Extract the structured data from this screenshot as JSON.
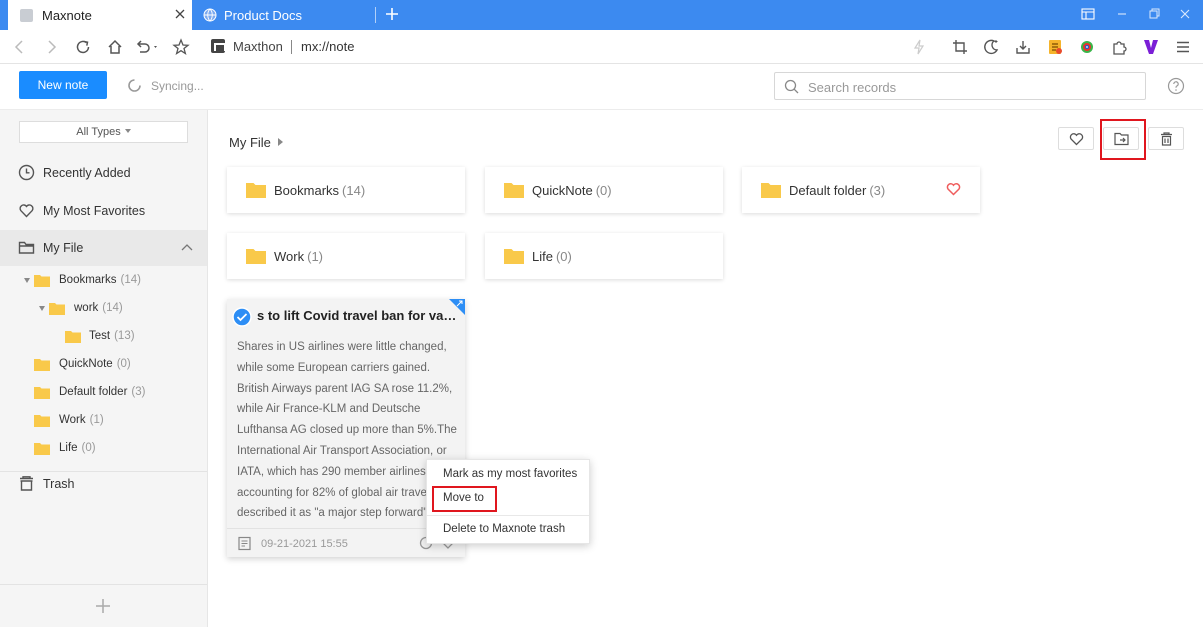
{
  "browser": {
    "tabs": [
      {
        "title": "Maxnote"
      },
      {
        "title": "Product Docs"
      }
    ],
    "address": {
      "site": "Maxthon",
      "url": "mx://note"
    }
  },
  "header": {
    "new_note_label": "New note",
    "sync_status": "Syncing...",
    "search_placeholder": "Search records"
  },
  "sidebar": {
    "type_filter": "All Types",
    "nav": {
      "recent": "Recently Added",
      "favorites": "My Most Favorites",
      "myfile": "My File",
      "trash": "Trash"
    },
    "tree": [
      {
        "label": "Bookmarks",
        "count": "(14)"
      },
      {
        "label": "work",
        "count": "(14)"
      },
      {
        "label": "Test",
        "count": "(13)"
      },
      {
        "label": "QuickNote",
        "count": "(0)"
      },
      {
        "label": "Default folder",
        "count": "(3)"
      },
      {
        "label": "Work",
        "count": "(1)"
      },
      {
        "label": "Life",
        "count": "(0)"
      }
    ]
  },
  "main": {
    "breadcrumb": "My File",
    "folders": [
      {
        "name": "Bookmarks",
        "count": "(14)"
      },
      {
        "name": "QuickNote",
        "count": "(0)"
      },
      {
        "name": "Default folder",
        "count": "(3)"
      },
      {
        "name": "Work",
        "count": "(1)"
      },
      {
        "name": "Life",
        "count": "(0)"
      }
    ],
    "note": {
      "title": "s to lift Covid travel ban for vac...",
      "body": "Shares in US airlines were little changed, while some European carriers gained. British Airways parent IAG SA rose 11.2%, while Air France-KLM and Deutsche Lufthansa AG closed up more than 5%.The International Air Transport Association, or IATA, which has 290 member airlines accounting for 82% of global air travel, described it as \"a major step forward\".",
      "date": "09-21-2021  15:55"
    },
    "context_menu": {
      "favorite": "Mark as my most favorites",
      "move": "Move to",
      "delete": "Delete to Maxnote trash"
    }
  },
  "colors": {
    "accent": "#1a8cff",
    "tabbar": "#3c8af0",
    "folder": "#f9c94a",
    "highlight": "#e0161e",
    "heart": "#ef5d5d"
  }
}
